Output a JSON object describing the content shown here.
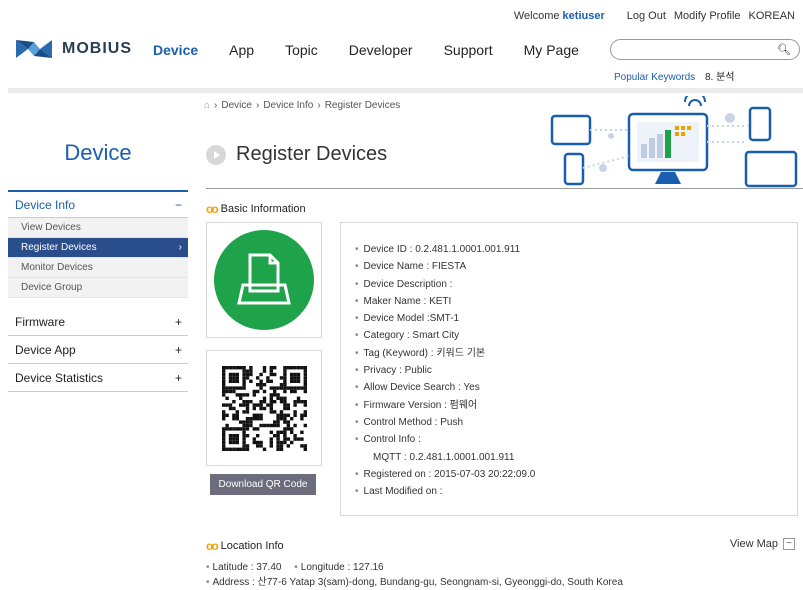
{
  "util": {
    "welcome": "Welcome",
    "user": "ketiuser",
    "logout": "Log Out",
    "modify": "Modify Profile",
    "lang": "KOREAN"
  },
  "brand": {
    "name": "MOBIUS",
    "accent": "#1a5fae",
    "nav_active_bg": "#2a4d8c",
    "qr_green": "#1fa34a"
  },
  "gnb": [
    "Device",
    "App",
    "Topic",
    "Developer",
    "Support",
    "My Page"
  ],
  "search": {
    "placeholder": "",
    "icon": "search-icon"
  },
  "popular": {
    "label": "Popular Keywords",
    "keyword": "8. 분석"
  },
  "lnb": {
    "title": "Device",
    "device_info": {
      "label": "Device Info",
      "toggle": "−"
    },
    "subs": [
      "View Devices",
      "Register Devices",
      "Monitor Devices",
      "Device Group"
    ],
    "menus": [
      "Firmware",
      "Device App",
      "Device Statistics"
    ],
    "plus": "+"
  },
  "breadcrumb": [
    "Device",
    "Device Info",
    "Register Devices"
  ],
  "page_title": "Register Devices",
  "basic": {
    "title": "Basic Information",
    "download": "Download QR Code",
    "fields": [
      "Device ID : 0.2.481.1.0001.001.911",
      "Device Name : FIESTA",
      "Device Description :",
      "Maker Name : KETI",
      "Device Model :SMT-1",
      "Category : Smart City",
      "Tag (Keyword) : 키워드 기본",
      "Privacy : Public",
      "Allow Device Search : Yes",
      "Firmware Version : 펌웨어",
      "Control Method : Push",
      "Control Info :"
    ],
    "control_detail": "MQTT : 0.2.481.1.0001.001.911",
    "fields_after": [
      "Registered on : 2015-07-03 20:22:09.0",
      "Last Modified on :"
    ]
  },
  "location": {
    "title": "Location Info",
    "view_map": "View Map",
    "latitude": "Latitude : 37.40",
    "longitude": "Longitude : 127.16",
    "address": "Address : 산77-6 Yatap 3(sam)-dong, Bundang-gu, Seongnam-si, Gyeonggi-do, South Korea"
  }
}
